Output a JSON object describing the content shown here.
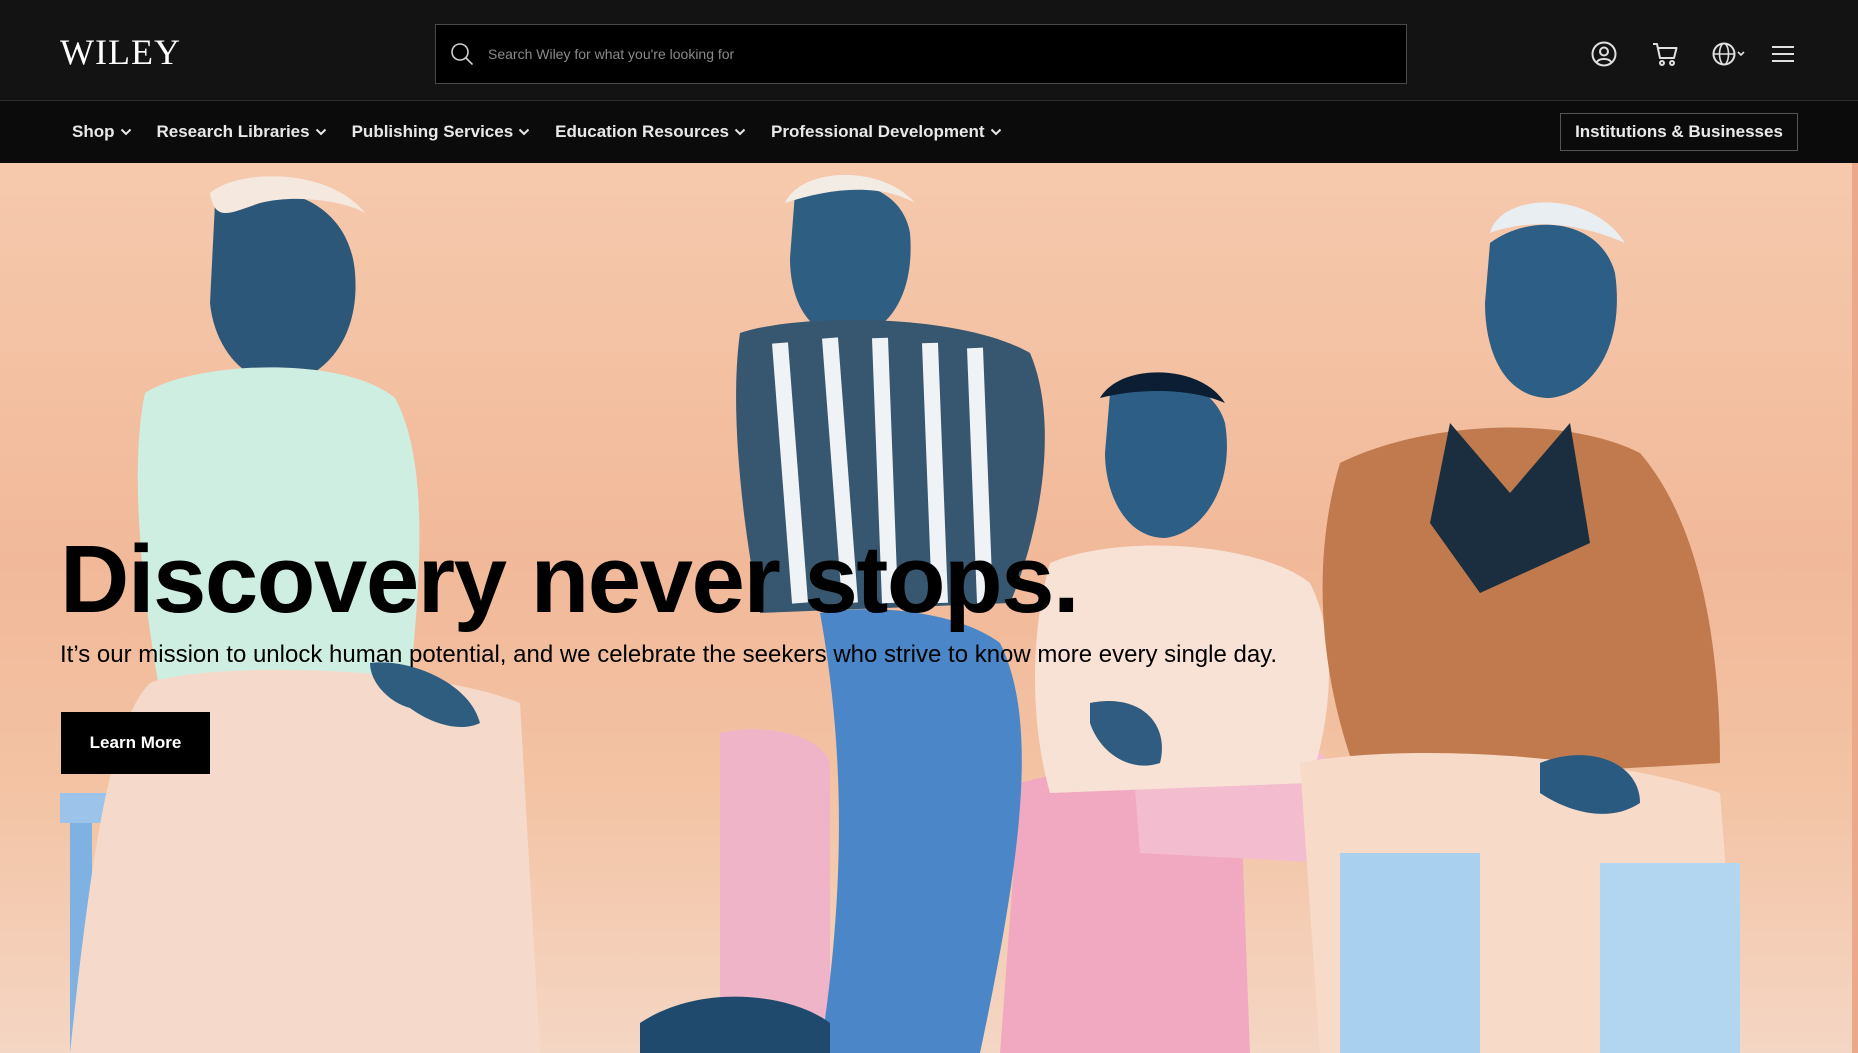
{
  "header": {
    "logo": "WILEY",
    "search": {
      "placeholder": "Search Wiley for what you're looking for",
      "value": ""
    },
    "icons": [
      "account-icon",
      "cart-icon",
      "globe-icon",
      "menu-icon"
    ]
  },
  "nav": {
    "items": [
      {
        "label": "Shop"
      },
      {
        "label": "Research Libraries"
      },
      {
        "label": "Publishing Services"
      },
      {
        "label": "Education Resources"
      },
      {
        "label": "Professional Development"
      }
    ],
    "institutions_label": "Institutions & Businesses"
  },
  "hero": {
    "headline": "Discovery never stops.",
    "subline": "It’s our mission to unlock human potential, and we celebrate the seekers who strive to know more every single day.",
    "cta_label": "Learn More"
  },
  "colors": {
    "topbar_bg": "#131313",
    "navbar_bg": "#0b0b0b",
    "hero_bg": "#f1b999",
    "cta_bg": "#000000"
  }
}
